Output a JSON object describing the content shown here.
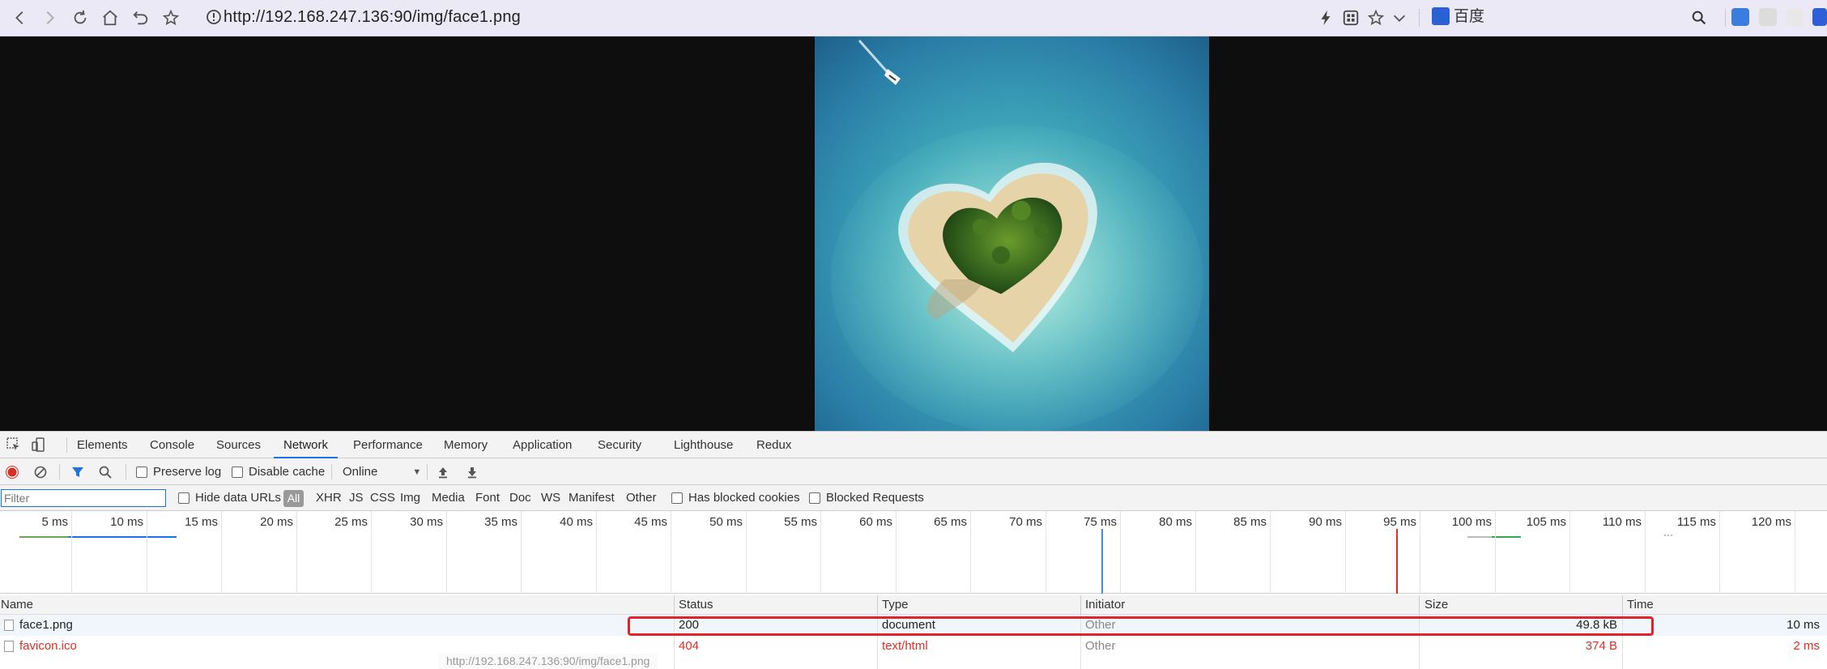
{
  "browser": {
    "url": "http://192.168.247.136:90/img/face1.png",
    "search_engine": "百度",
    "baidu_icon_text": "🐾"
  },
  "devtools": {
    "tabs": [
      "Elements",
      "Console",
      "Sources",
      "Network",
      "Performance",
      "Memory",
      "Application",
      "Security",
      "Lighthouse",
      "Redux"
    ],
    "active_tab": "Network",
    "toolbar": {
      "preserve_log": "Preserve log",
      "disable_cache": "Disable cache",
      "throttle": "Online"
    },
    "filter": {
      "placeholder": "Filter",
      "hide_data_urls": "Hide data URLs",
      "types": [
        "All",
        "XHR",
        "JS",
        "CSS",
        "Img",
        "Media",
        "Font",
        "Doc",
        "WS",
        "Manifest",
        "Other"
      ],
      "has_blocked_cookies": "Has blocked cookies",
      "blocked_requests": "Blocked Requests"
    },
    "timeline_ticks": [
      "5 ms",
      "10 ms",
      "15 ms",
      "20 ms",
      "25 ms",
      "30 ms",
      "35 ms",
      "40 ms",
      "45 ms",
      "50 ms",
      "55 ms",
      "60 ms",
      "65 ms",
      "70 ms",
      "75 ms",
      "80 ms",
      "85 ms",
      "90 ms",
      "95 ms",
      "100 ms",
      "105 ms",
      "110 ms",
      "115 ms",
      "120 ms"
    ],
    "columns": [
      "Name",
      "Status",
      "Type",
      "Initiator",
      "Size",
      "Time"
    ],
    "rows": [
      {
        "name": "face1.png",
        "status": "200",
        "type": "document",
        "initiator": "Other",
        "size": "49.8 kB",
        "time": "10 ms"
      },
      {
        "name": "favicon.ico",
        "status": "404",
        "type": "text/html",
        "initiator": "Other",
        "size": "374 B",
        "time": "2 ms"
      }
    ],
    "tooltip": "http://192.168.247.136:90/img/face1.png"
  },
  "colors": {
    "error_red": "#d93025",
    "highlight_red": "#e3222b",
    "accent_blue": "#1a73e8"
  }
}
